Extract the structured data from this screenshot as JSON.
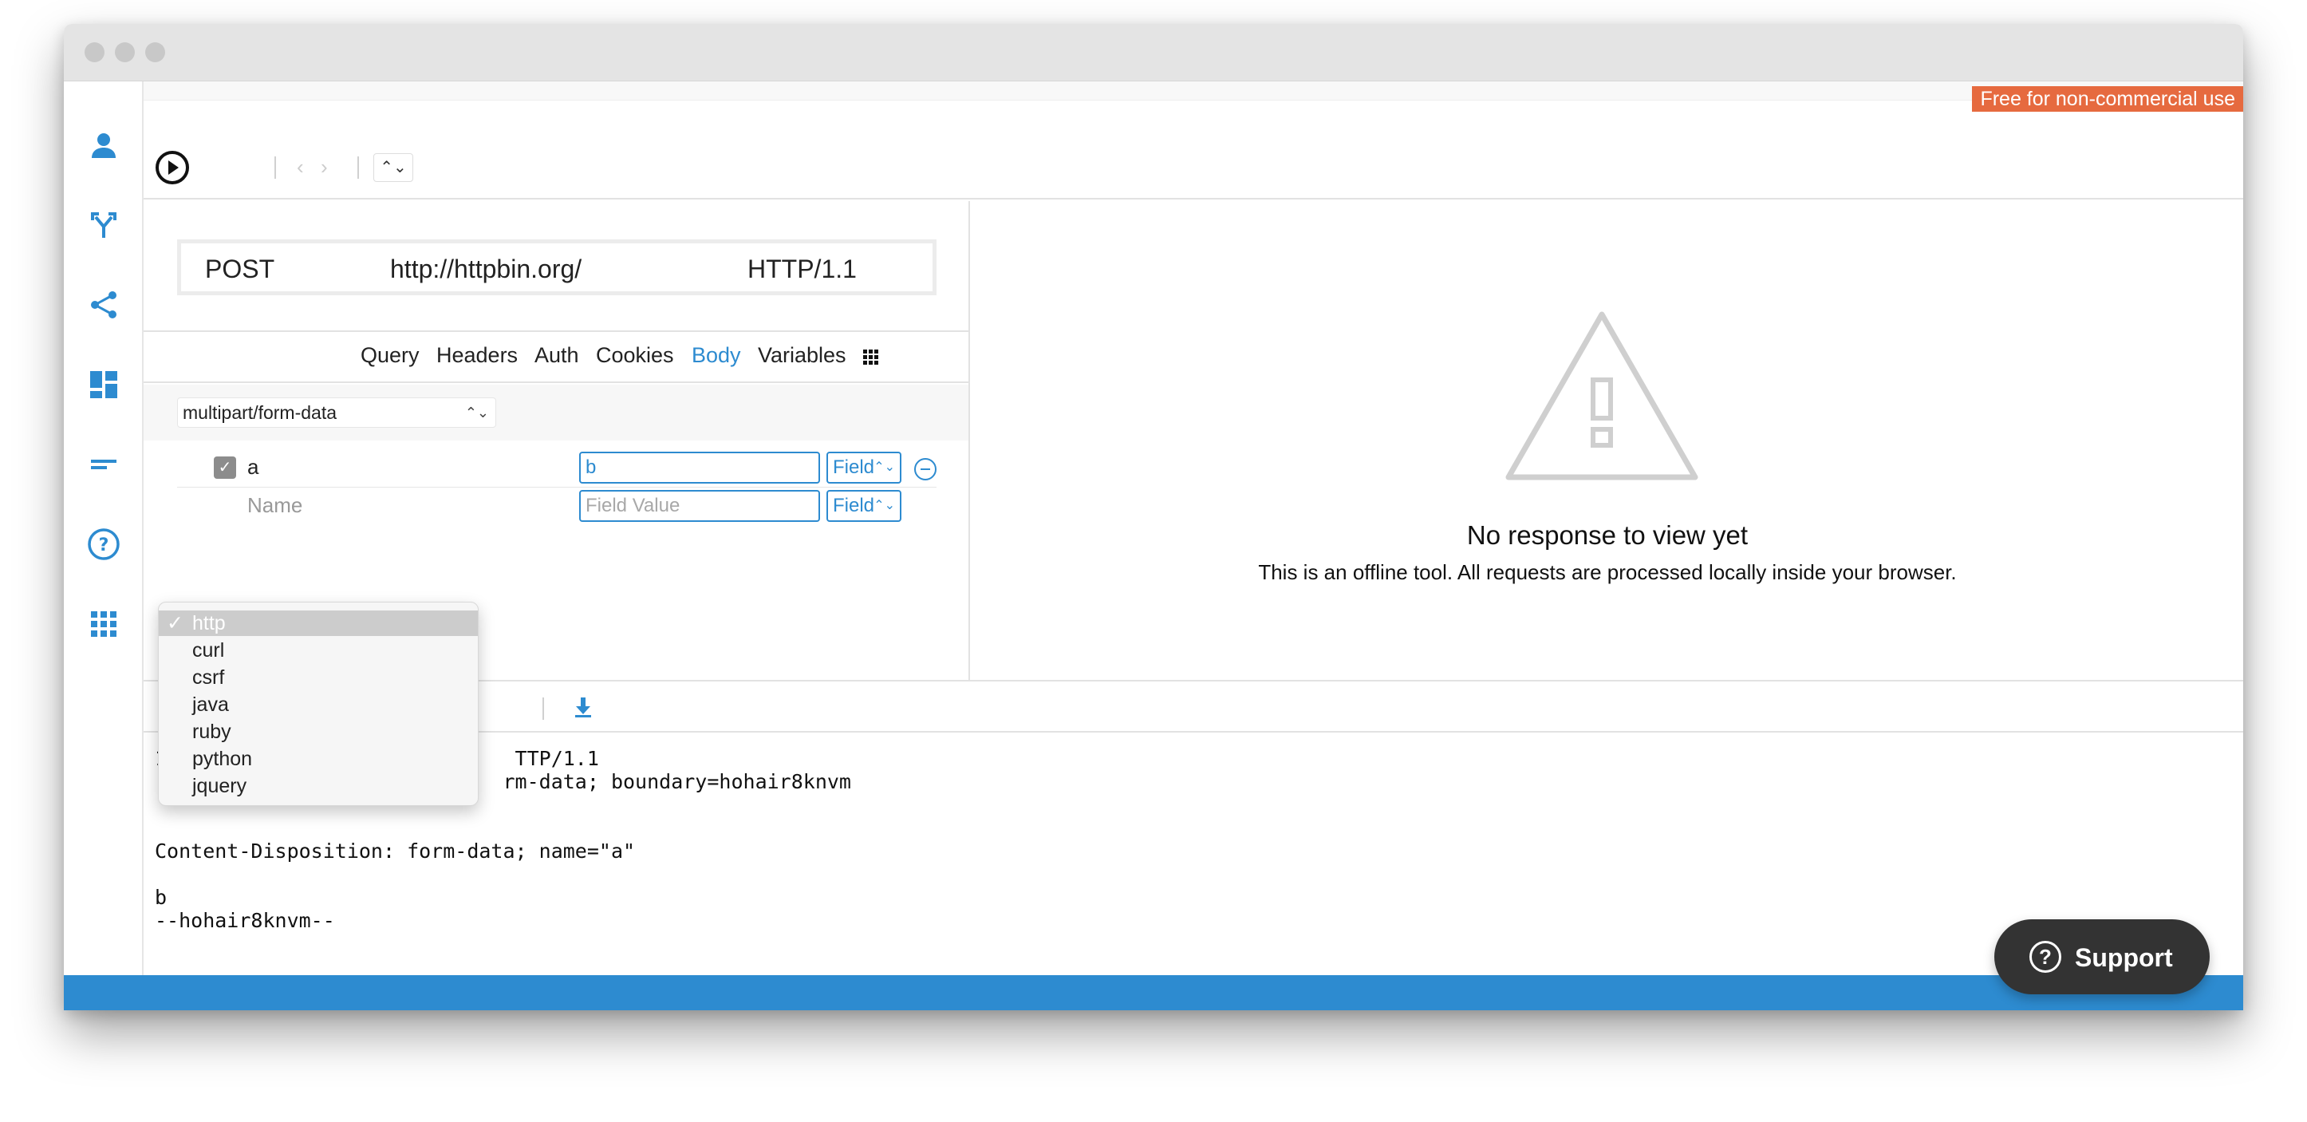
{
  "banner": "Free for non-commercial use",
  "request": {
    "method": "POST",
    "url": "http://httpbin.org/",
    "protocol": "HTTP/1.1"
  },
  "tabs": [
    {
      "label": "Query"
    },
    {
      "label": "Headers"
    },
    {
      "label": "Auth"
    },
    {
      "label": "Cookies"
    },
    {
      "label": "Body",
      "active": true
    },
    {
      "label": "Variables"
    }
  ],
  "body": {
    "content_type": "multipart/form-data",
    "fields": [
      {
        "name": "a",
        "value": "b",
        "type": "Field",
        "checked": true
      },
      {
        "name_placeholder": "Name",
        "value_placeholder": "Field Value",
        "type": "Field"
      }
    ]
  },
  "response": {
    "title": "No response to view yet",
    "subtitle": "This is an offline tool. All requests are processed locally inside your browser."
  },
  "code_lines": [
    "1                             TTP/1.1",
    "                             rm-data; boundary=hohair8knvm",
    "",
    "",
    "Content-Disposition: form-data; name=\"a\"",
    "",
    "b",
    "--hohair8knvm--"
  ],
  "format_dropdown": {
    "options": [
      "http",
      "curl",
      "csrf",
      "java",
      "ruby",
      "python",
      "jquery"
    ],
    "selected": "http"
  },
  "support_label": "Support",
  "colors": {
    "accent": "#2d8bd0",
    "banner": "#e66a3f",
    "support_bg": "#333333"
  }
}
